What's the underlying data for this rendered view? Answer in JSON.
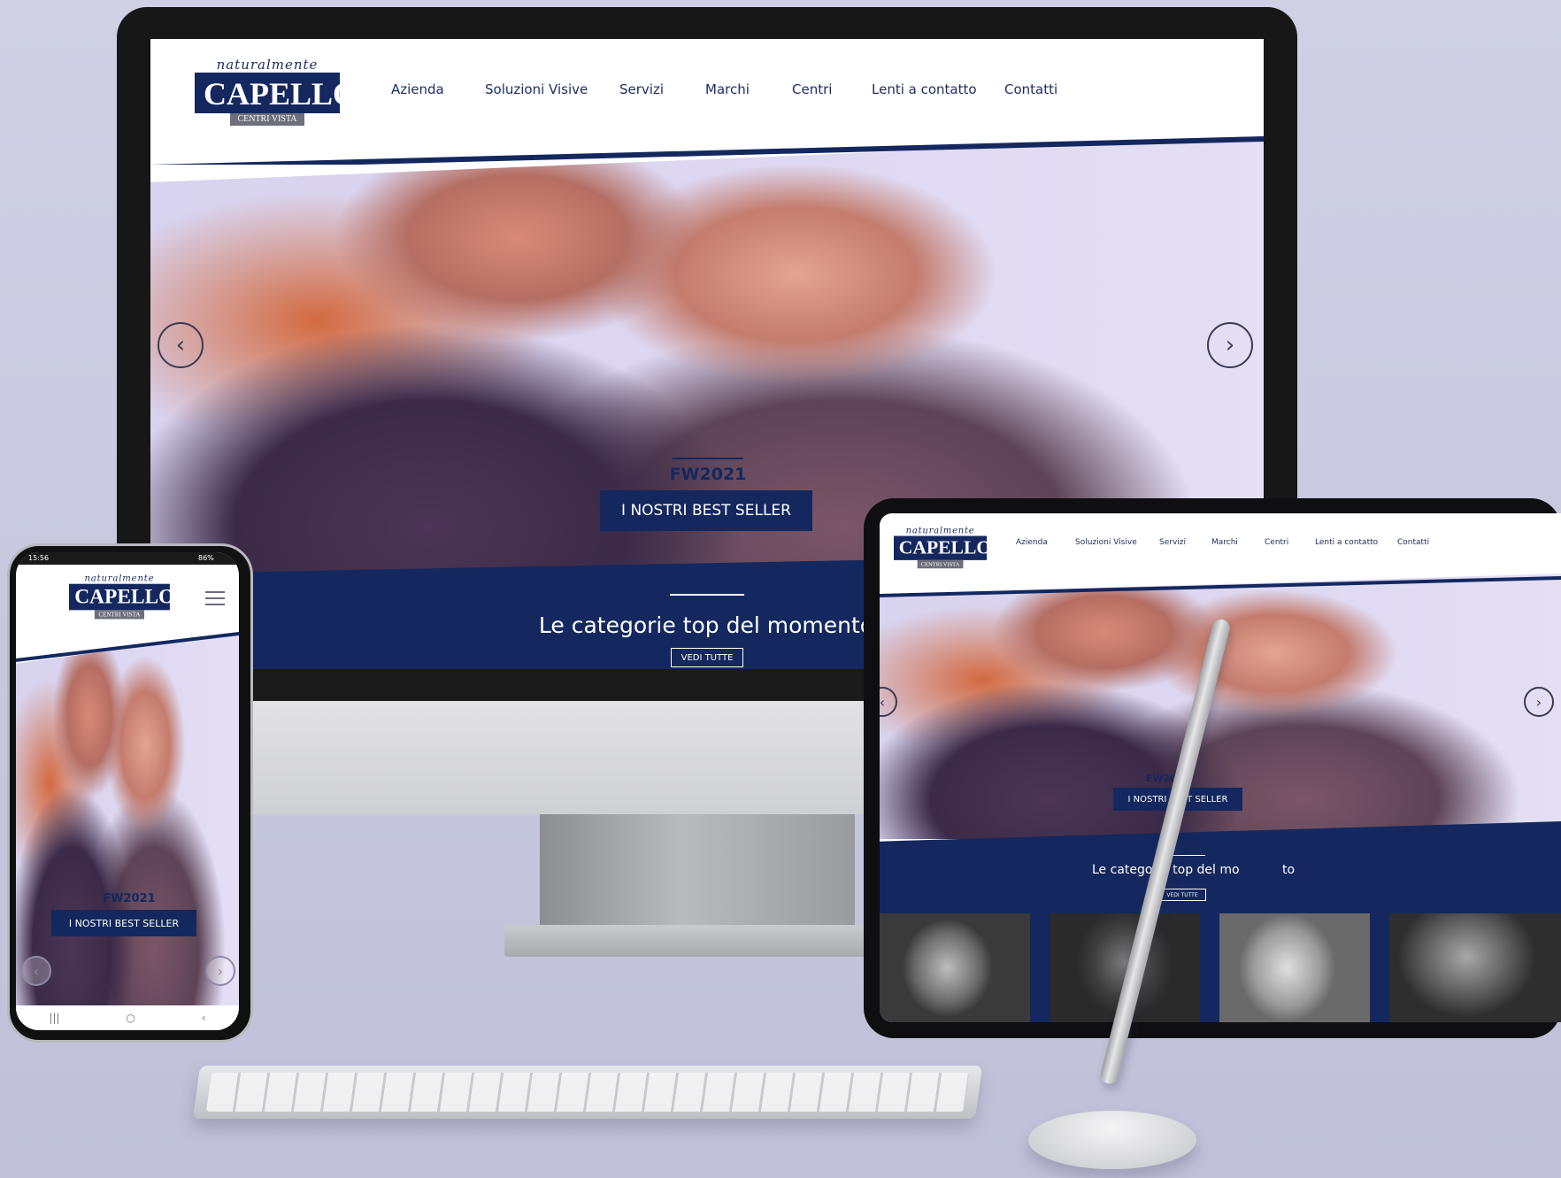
{
  "brand": {
    "script": "naturalmente",
    "name": "CAPELLO",
    "sub": "CENTRI VISTA"
  },
  "nav": {
    "items": [
      "Azienda",
      "Soluzioni Visive",
      "Servizi",
      "Marchi",
      "Centri",
      "Lenti a contatto",
      "Contatti"
    ]
  },
  "hero": {
    "season": "FW2021",
    "cta": "I NOSTRI BEST SELLER",
    "prev_icon": "chevron-left-icon",
    "next_icon": "chevron-right-icon"
  },
  "categories": {
    "title": "Le categorie top del momento",
    "title_tablet": "Le categorie top del mo",
    "title_tablet_end": "to",
    "button": "VEDI TUTTE"
  },
  "phone_status": {
    "time": "15:56",
    "battery": "86%"
  },
  "colors": {
    "navy": "#14285f",
    "background": "#c7c8de"
  }
}
